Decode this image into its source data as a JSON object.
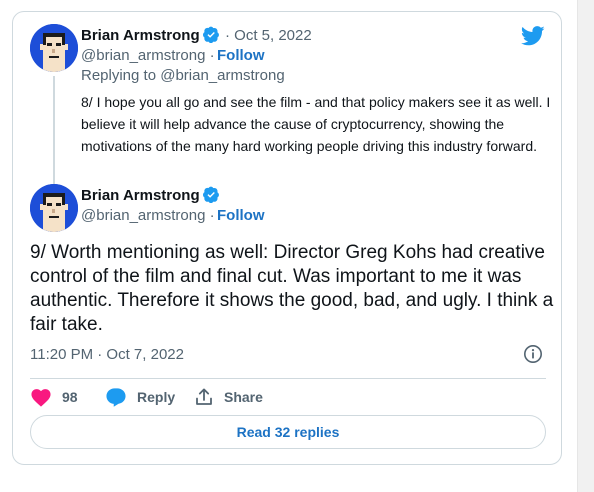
{
  "quoted_tweet": {
    "author_name": "Brian Armstrong",
    "date": "· Oct 5, 2022",
    "handle": "@brian_armstrong ·",
    "follow_label": "Follow",
    "replying_to": "Replying to @brian_armstrong",
    "text": "8/ I hope you all go and see the film - and that policy makers see it as well. I believe it will help advance the cause of cryptocurrency, showing the motivations of the many hard working people driving this industry forward."
  },
  "main_tweet": {
    "author_name": "Brian Armstrong",
    "handle": "@brian_armstrong ·",
    "follow_label": "Follow",
    "text": "9/ Worth mentioning as well: Director Greg Kohs had creative control of the film and final cut. Was important to me it was authentic. Therefore it shows the good, bad, and ugly. I think a fair take.",
    "timestamp": "11:20 PM · Oct 7, 2022"
  },
  "actions": {
    "like_count": "98",
    "reply_label": "Reply",
    "share_label": "Share"
  },
  "read_replies_label": "Read 32 replies",
  "icons": {
    "brand": "twitter-bird-icon",
    "verified": "verified-badge-icon",
    "info": "info-icon",
    "like": "heart-icon",
    "reply": "speech-bubble-icon",
    "share": "share-icon"
  },
  "colors": {
    "accent": "#1d9bf0",
    "link": "#1d73c4",
    "like": "#f91880",
    "muted": "#536471",
    "border": "#cfd9de",
    "avatar_bg": "#1d4ed8"
  }
}
